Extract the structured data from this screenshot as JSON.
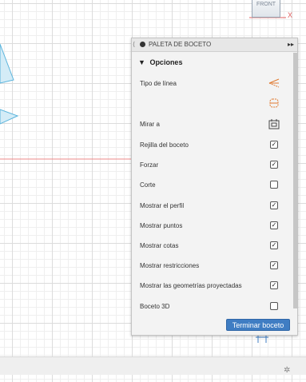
{
  "viewcube": {
    "face_label": "FRONT",
    "axis_label": "X"
  },
  "palette": {
    "title": "PALETA DE BOCETO",
    "section_label": "Opciones",
    "rows": [
      {
        "label": "Tipo de línea",
        "control": "linetype-icon"
      },
      {
        "label": "",
        "control": "slice-icon"
      },
      {
        "label": "Mirar a",
        "control": "look-at-icon"
      },
      {
        "label": "Rejilla del boceto",
        "checked": true
      },
      {
        "label": "Forzar",
        "checked": true
      },
      {
        "label": "Corte",
        "checked": false
      },
      {
        "label": "Mostrar el perfil",
        "checked": true
      },
      {
        "label": "Mostrar puntos",
        "checked": true
      },
      {
        "label": "Mostrar cotas",
        "checked": true
      },
      {
        "label": "Mostrar restricciones",
        "checked": true
      },
      {
        "label": "Mostrar las geometrías proyectadas",
        "checked": true
      },
      {
        "label": "Boceto 3D",
        "checked": false
      }
    ],
    "finish_button_label": "Terminar boceto"
  },
  "colors": {
    "accent": "#3f7dc3",
    "sketch_shape": "#5ab4dc",
    "x_axis": "#e06060"
  }
}
